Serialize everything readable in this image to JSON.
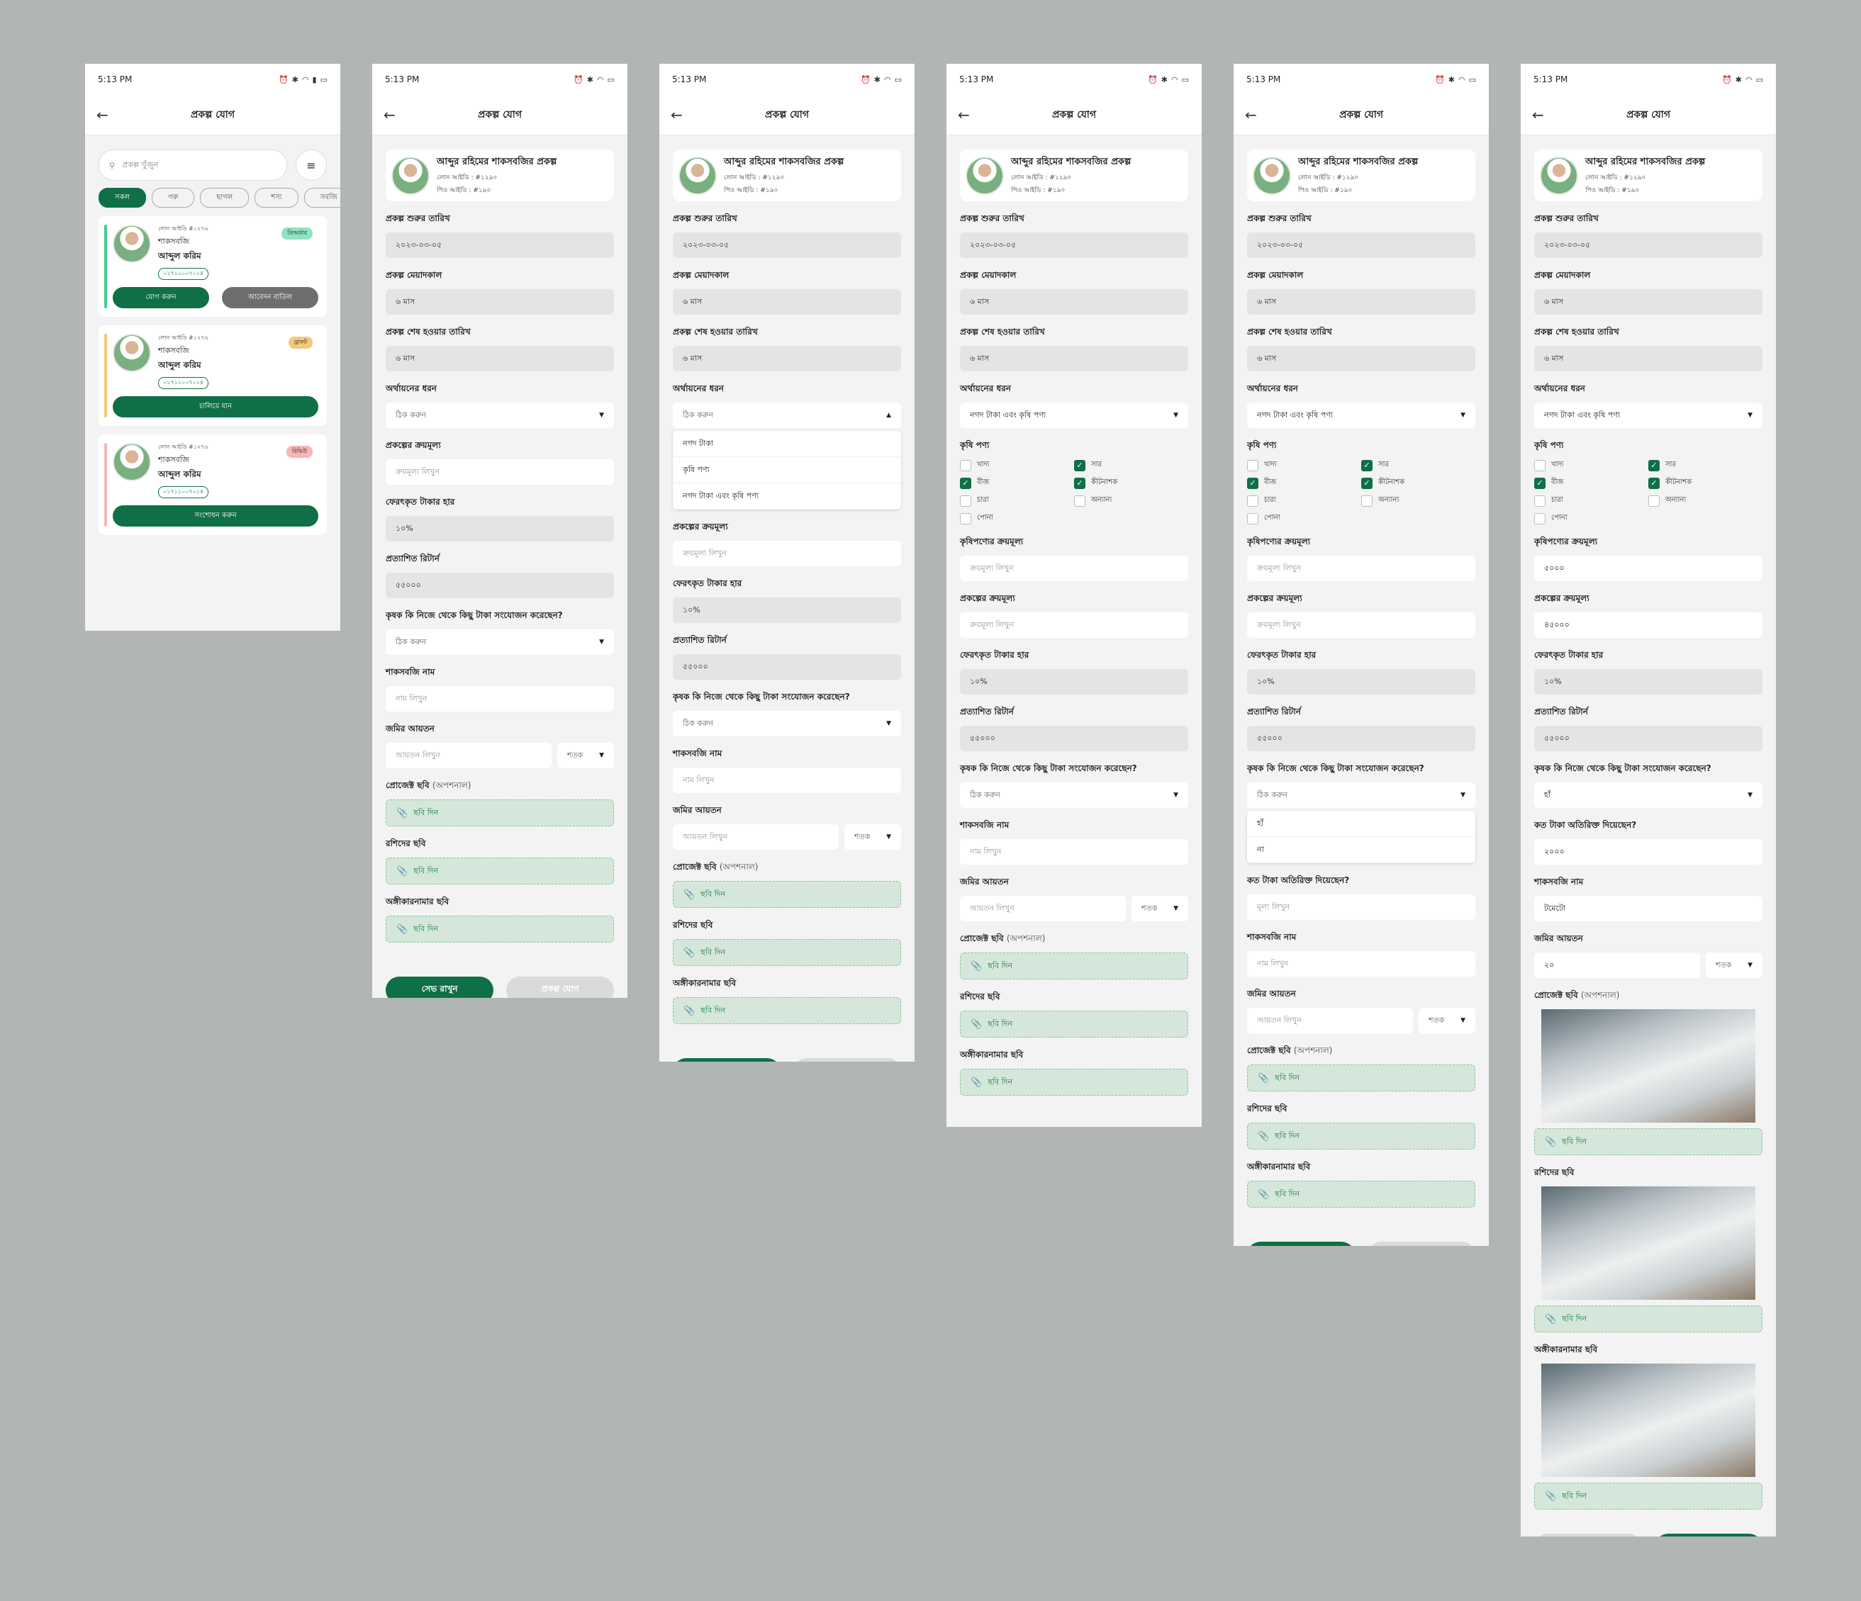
{
  "status": {
    "time": "5:13 PM",
    "icons": [
      "alarm-icon",
      "bluetooth-icon",
      "wifi-icon",
      "signal-icon",
      "battery-icon"
    ]
  },
  "appbar": {
    "title": "প্রকল্প যোগ"
  },
  "list_screen": {
    "search_placeholder": "প্রকল্প খুঁজুন",
    "chips": [
      "সকল",
      "গরু",
      "ছাগল",
      "শস্য",
      "সবজি"
    ],
    "cards": [
      {
        "loan_id": "লোন আইডি #১২৭৬",
        "crop": "শাকসবজি",
        "farmer": "আব্দুল করিম",
        "phone": "০১৭১১০০৭০১৪",
        "badge": "প্রিঅর্ডার",
        "badge_bg": "#8fe3c0",
        "accent": "#3fcf8e",
        "buttons": [
          "যোগ করুন",
          "আবেদন বাতিল"
        ]
      },
      {
        "loan_id": "লোন আইডি #১২৭৬",
        "crop": "শাকসবজি",
        "farmer": "আব্দুল করিম",
        "phone": "০১৭১১০০৭০১৪",
        "badge": "ড্রাফট",
        "badge_bg": "#f3c87a",
        "accent": "#f3c87a",
        "buttons": [
          "চালিয়ে যান"
        ]
      },
      {
        "loan_id": "লোন আইডি #১২৭৬",
        "crop": "শাকসবজি",
        "farmer": "আব্দুল করিম",
        "phone": "০১৭১১০০৭০১৪",
        "badge": "রিভিউ",
        "badge_bg": "#f7b5b5",
        "accent": "#f7b5b5",
        "buttons": [
          "সংশোধন করুন"
        ]
      }
    ]
  },
  "project": {
    "title": "আব্দুর রহিমের শাকসবজির প্রকল্প",
    "loan_id": "লোন আইডি :  #১২৯০",
    "parent_id": "পিও আইডি :  #১৯০"
  },
  "labels": {
    "start_date": "প্রকল্প শুরুর তারিখ",
    "duration": "প্রকল্প মেয়াদকাল",
    "end_date": "প্রকল্প শেষ হওয়ার তারিখ",
    "finance_type": "অর্থায়নের ধরন",
    "purchase_price": "প্রকল্পের ক্রয়মূল্য",
    "return_rate": "ফেরৎকৃত টাকার হার",
    "expected_return": "প্রত্যাশিত রিটার্ন",
    "farmer_added": "কৃষক কি নিজে থেকে কিছু টাকা সংযোজন করেছেন?",
    "extra_amount": "কত টাকা অতিরিক্ত দিয়েছেন?",
    "vegetable_name": "শাকসবজি নাম",
    "land_size": "জমির আয়তন",
    "project_photo": "প্রোজেক্ট ছবি",
    "optional": "(অপশনাল)",
    "receipt_photo": "রশিদের ছবি",
    "agreement_photo": "অঙ্গীকারনামার ছবি",
    "agri_products": "কৃষি পণ্য",
    "agri_price": "কৃষিপণ্যের ক্রয়মূল্য"
  },
  "values": {
    "start_date": "২০২৩-০৩-০৫",
    "duration": "৬ মাস",
    "end_date": "৬ মাস",
    "return_rate": "১০%",
    "expected_return": "৫৫০০০",
    "finance_selected": "নগদ টাকা এবং কৃষি পণ্য",
    "agri_price": "৫০০০",
    "purchase_price": "৪৫০০০",
    "farmer_added": "হাঁ",
    "extra_amount": "২০০০",
    "vegetable_name": "টমেটো",
    "land_size": "২০"
  },
  "placeholders": {
    "select": "ঠিক করুন",
    "price": "ক্রয়মূল্য লিখুন",
    "name": "নাম লিখুন",
    "area": "আয়তন লিখুন",
    "unit": "শতক",
    "amount": "মূল্য লিখুন",
    "upload": "ছবি দিন"
  },
  "finance_options": [
    "নগদ টাকা",
    "কৃষি পণ্য",
    "নগদ টাকা এবং কৃষি পণ্য"
  ],
  "yes_no": [
    "হাঁ",
    "না"
  ],
  "checks": [
    {
      "label": "খাদ্য",
      "on": false
    },
    {
      "label": "সার",
      "on": true
    },
    {
      "label": "বীজ",
      "on": true
    },
    {
      "label": "কীটনাশক",
      "on": true
    },
    {
      "label": "চারা",
      "on": false
    },
    {
      "label": "অন্যান্য",
      "on": false
    },
    {
      "label": "পোনা",
      "on": false
    }
  ],
  "buttons": {
    "save": "সেভ রাখুন",
    "add": "প্রকল্প যোগ"
  },
  "colors": {
    "primary": "#0f6f47",
    "upload_bg": "#d5e7da"
  }
}
